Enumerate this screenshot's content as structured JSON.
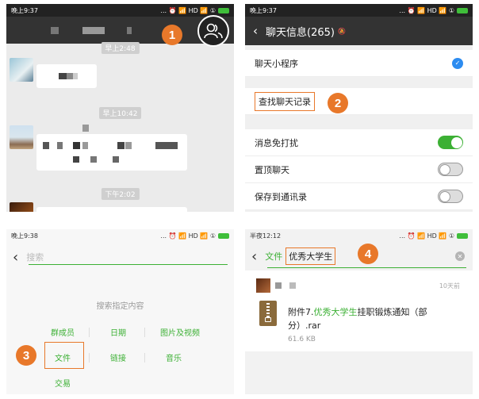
{
  "panel1": {
    "status_time": "晚上9:37",
    "status_icons": "... ⏰ 📶 HD 📶 ①",
    "times": [
      "早上2:48",
      "早上10:42",
      "下午2:02"
    ],
    "badge": "1"
  },
  "panel2": {
    "status_time": "晚上9:37",
    "status_icons": "... ⏰ 📶 HD 📶 ①",
    "title": "聊天信息(265)",
    "row_mini_program": "聊天小程序",
    "row_find_history": "查找聊天记录",
    "row_mute": "消息免打扰",
    "row_pin": "置顶聊天",
    "row_save_contacts": "保存到通讯录",
    "badge": "2"
  },
  "panel3": {
    "status_time": "晚上9:38",
    "status_icons": "... ⏰ 📶 HD 📶 ①",
    "search_placeholder": "搜索",
    "hint": "搜索指定内容",
    "cat_members": "群成员",
    "cat_date": "日期",
    "cat_media": "图片及视频",
    "cat_file": "文件",
    "cat_link": "链接",
    "cat_music": "音乐",
    "cat_trade": "交易",
    "badge": "3"
  },
  "panel4": {
    "status_time": "半夜12:12",
    "status_icons": "... ⏰ 📶 HD 📶 ①",
    "filter_tag": "文件",
    "query": "优秀大学生",
    "badge": "4",
    "result_time": "10天前",
    "file_name_prefix": "附件7.",
    "file_name_highlight": "优秀大学生",
    "file_name_suffix": "挂职锻炼通知（部分）.rar",
    "file_size": "61.6 KB"
  },
  "colors": {
    "accent_green": "#3cb034",
    "badge_orange": "#e8782a"
  }
}
